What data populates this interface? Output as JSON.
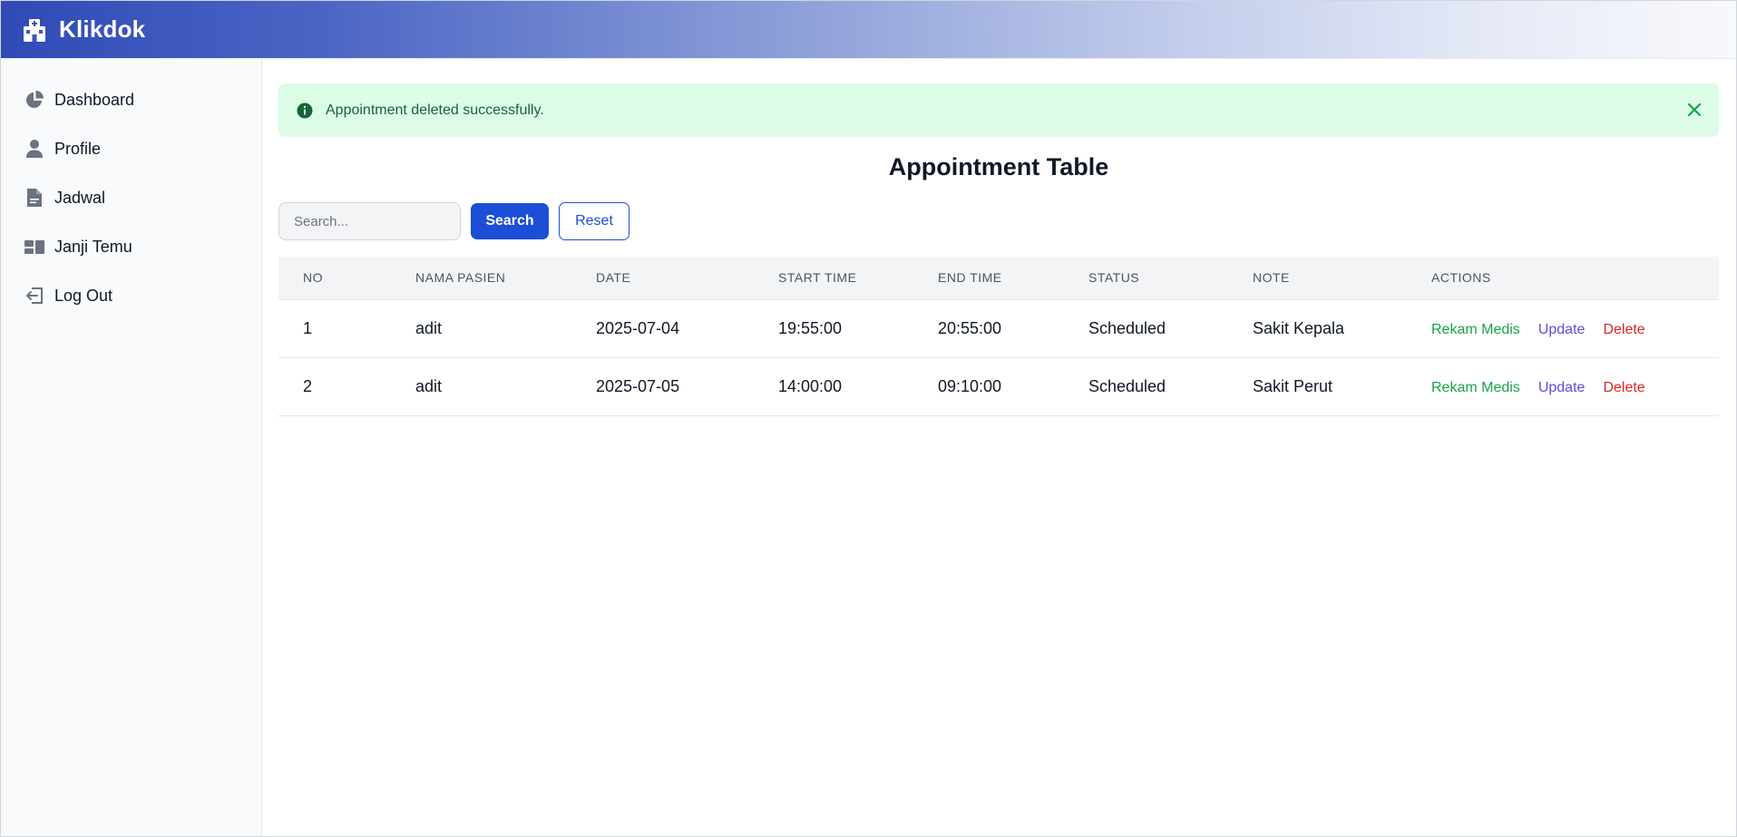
{
  "app": {
    "brand": "Klikdok"
  },
  "sidebar": {
    "items": [
      {
        "label": "Dashboard",
        "icon": "pie-chart-icon"
      },
      {
        "label": "Profile",
        "icon": "user-icon"
      },
      {
        "label": "Jadwal",
        "icon": "document-icon"
      },
      {
        "label": "Janji Temu",
        "icon": "grid-icon"
      },
      {
        "label": "Log Out",
        "icon": "logout-icon"
      }
    ]
  },
  "alert": {
    "message": "Appointment deleted successfully.",
    "icon": "info-icon",
    "close_icon": "close-icon"
  },
  "main": {
    "title": "Appointment Table",
    "search": {
      "placeholder": "Search...",
      "value": "",
      "button": "Search",
      "reset": "Reset"
    }
  },
  "table": {
    "headers": [
      "NO",
      "NAMA PASIEN",
      "DATE",
      "START TIME",
      "END TIME",
      "STATUS",
      "NOTE",
      "ACTIONS"
    ],
    "actions": {
      "rekam": "Rekam Medis",
      "update": "Update",
      "delete": "Delete"
    },
    "rows": [
      {
        "no": "1",
        "nama": "adit",
        "date": "2025-07-04",
        "start": "19:55:00",
        "end": "20:55:00",
        "status": "Scheduled",
        "note": "Sakit Kepala"
      },
      {
        "no": "2",
        "nama": "adit",
        "date": "2025-07-05",
        "start": "14:00:00",
        "end": "09:10:00",
        "status": "Scheduled",
        "note": "Sakit Perut"
      }
    ]
  },
  "colors": {
    "primary": "#1d4ed8",
    "alert_bg": "#dcfce7",
    "alert_text": "#166534",
    "action_rekam": "#16a34a",
    "action_update": "#5b4fd8",
    "action_delete": "#dc2626"
  }
}
